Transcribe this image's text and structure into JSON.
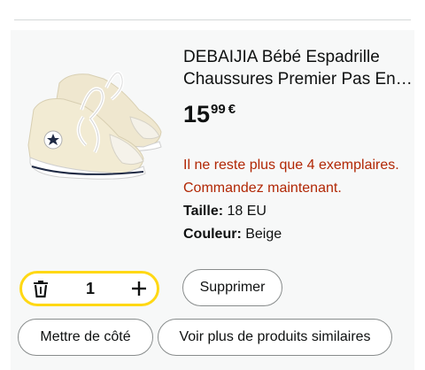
{
  "product": {
    "title_line1": "DEBAIJIA Bébé Espadrille",
    "title_line2": "Chaussures Premier Pas En…",
    "price_whole": "15",
    "price_fraction": "99",
    "price_currency": "€",
    "stock_message": "Il ne reste plus que 4 exemplaires. Commandez maintenant.",
    "size_label": "Taille:",
    "size_value": "18 EU",
    "color_label": "Couleur:",
    "color_value": "Beige",
    "image_icon": "baby-canvas-sneakers"
  },
  "cart": {
    "quantity": "1",
    "delete_label": "Supprimer",
    "save_later_label": "Mettre de côté",
    "similar_label": "Voir plus de produits similaires"
  },
  "colors": {
    "stepper_border": "#ffd814",
    "stock_red": "#b12704",
    "card_bg": "#f7f8f8"
  }
}
